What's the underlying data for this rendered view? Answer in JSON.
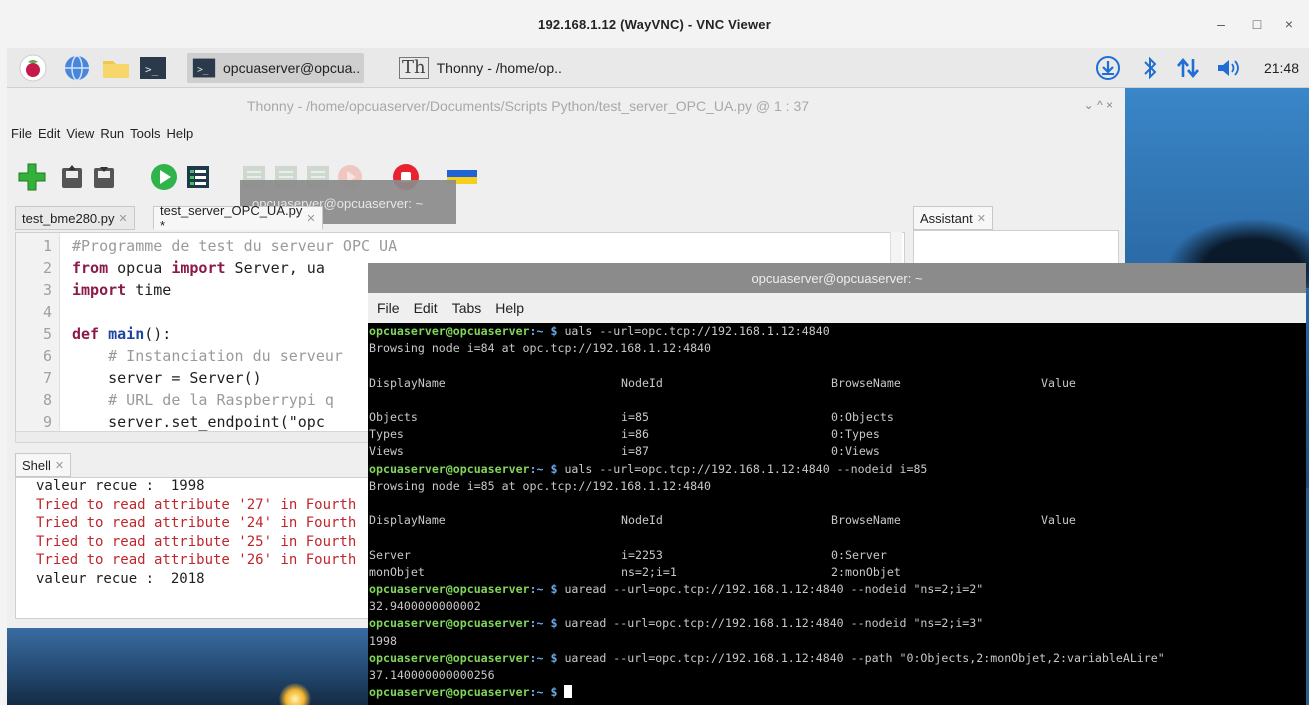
{
  "vnc": {
    "title": "192.168.1.12 (WayVNC) - VNC Viewer",
    "minimize": "–",
    "maximize": "□",
    "close": "×"
  },
  "taskbar": {
    "terminal_task": "opcuaserver@opcua..",
    "thonny_task": "Thonny  -  /home/op..",
    "thonny_glyph": "Th",
    "clock": "21:48"
  },
  "thonny": {
    "title": "Thonny  -  /home/opcuaserver/Documents/Scripts Python/test_server_OPC_UA.py  @  1 : 37",
    "window_controls": "⌄  ^  ×",
    "menu": [
      "File",
      "Edit",
      "View",
      "Run",
      "Tools",
      "Help"
    ],
    "tooltip": "opcuaserver@opcuaserver: ~",
    "tabs": [
      {
        "label": "test_bme280.py",
        "close": "✕"
      },
      {
        "label": "test_server_OPC_UA.py *",
        "close": "✕"
      }
    ],
    "assistant_tab": {
      "label": "Assistant",
      "close": "✕"
    },
    "shell_tab": {
      "label": "Shell",
      "close": "✕"
    },
    "code": [
      {
        "n": "1",
        "parts": [
          {
            "t": "#Programme de test du serveur OPC UA",
            "c": "c-com"
          }
        ]
      },
      {
        "n": "2",
        "parts": [
          {
            "t": "from",
            "c": "c-kw"
          },
          {
            "t": " opcua ",
            "c": ""
          },
          {
            "t": "import",
            "c": "c-kw"
          },
          {
            "t": " Server, ua",
            "c": ""
          }
        ]
      },
      {
        "n": "3",
        "parts": [
          {
            "t": "import",
            "c": "c-kw"
          },
          {
            "t": " time",
            "c": ""
          }
        ]
      },
      {
        "n": "4",
        "parts": []
      },
      {
        "n": "5",
        "parts": [
          {
            "t": "def",
            "c": "c-kw"
          },
          {
            "t": " ",
            "c": ""
          },
          {
            "t": "main",
            "c": "c-fn"
          },
          {
            "t": "():",
            "c": ""
          }
        ]
      },
      {
        "n": "6",
        "parts": [
          {
            "t": "    # Instanciation du serveur",
            "c": "c-com"
          }
        ]
      },
      {
        "n": "7",
        "parts": [
          {
            "t": "    server = Server()",
            "c": ""
          }
        ]
      },
      {
        "n": "8",
        "parts": [
          {
            "t": "    # URL de la Raspberrypi q",
            "c": "c-com"
          }
        ]
      },
      {
        "n": "9",
        "parts": [
          {
            "t": "    server.set_endpoint(\"opc",
            "c": ""
          }
        ]
      }
    ],
    "shell": [
      {
        "t": "valeur recue :  1998",
        "c": "sh-out"
      },
      {
        "t": "Tried to read attribute '27' in Fourth",
        "c": "sh-err"
      },
      {
        "t": "Tried to read attribute '24' in Fourth",
        "c": "sh-err"
      },
      {
        "t": "Tried to read attribute '25' in Fourth",
        "c": "sh-err"
      },
      {
        "t": "Tried to read attribute '26' in Fourth",
        "c": "sh-err"
      },
      {
        "t": "valeur recue :  2018",
        "c": "sh-out"
      }
    ]
  },
  "terminal": {
    "title": "opcuaserver@opcuaserver: ~",
    "menu": [
      "File",
      "Edit",
      "Tabs",
      "Help"
    ],
    "prompt_user": "opcuaserver@opcuaserver",
    "prompt_path": ":~ $",
    "lines": [
      {
        "kind": "cmd",
        "text": " uals --url=opc.tcp://192.168.1.12:4840"
      },
      {
        "kind": "out",
        "text": "Browsing node i=84 at opc.tcp://192.168.1.12:4840"
      },
      {
        "kind": "blank"
      },
      {
        "kind": "cols",
        "cells": [
          "DisplayName",
          "NodeId",
          "BrowseName",
          "Value"
        ]
      },
      {
        "kind": "blank"
      },
      {
        "kind": "cols",
        "cells": [
          "Objects",
          "i=85",
          "0:Objects",
          ""
        ]
      },
      {
        "kind": "cols",
        "cells": [
          "Types",
          "i=86",
          "0:Types",
          ""
        ]
      },
      {
        "kind": "cols",
        "cells": [
          "Views",
          "i=87",
          "0:Views",
          ""
        ]
      },
      {
        "kind": "cmd",
        "text": " uals --url=opc.tcp://192.168.1.12:4840 --nodeid i=85"
      },
      {
        "kind": "out",
        "text": "Browsing node i=85 at opc.tcp://192.168.1.12:4840"
      },
      {
        "kind": "blank"
      },
      {
        "kind": "cols",
        "cells": [
          "DisplayName",
          "NodeId",
          "BrowseName",
          "Value"
        ]
      },
      {
        "kind": "blank"
      },
      {
        "kind": "cols",
        "cells": [
          "Server",
          "i=2253",
          "0:Server",
          ""
        ]
      },
      {
        "kind": "cols",
        "cells": [
          "monObjet",
          "ns=2;i=1",
          "2:monObjet",
          ""
        ]
      },
      {
        "kind": "cmd",
        "text": " uaread --url=opc.tcp://192.168.1.12:4840 --nodeid \"ns=2;i=2\""
      },
      {
        "kind": "out",
        "text": "32.9400000000002"
      },
      {
        "kind": "cmd",
        "text": " uaread --url=opc.tcp://192.168.1.12:4840 --nodeid \"ns=2;i=3\""
      },
      {
        "kind": "out",
        "text": "1998"
      },
      {
        "kind": "cmd",
        "text": " uaread --url=opc.tcp://192.168.1.12:4840 --path \"0:Objects,2:monObjet,2:variableALire\""
      },
      {
        "kind": "out",
        "text": "37.140000000000256"
      },
      {
        "kind": "cmd",
        "text": " ",
        "cursor": true
      }
    ]
  },
  "colors": {
    "prompt_green": "#7fd65a",
    "prompt_blue": "#6aa8e6",
    "error_red": "#c0262d",
    "keyword": "#8a1a4a"
  }
}
